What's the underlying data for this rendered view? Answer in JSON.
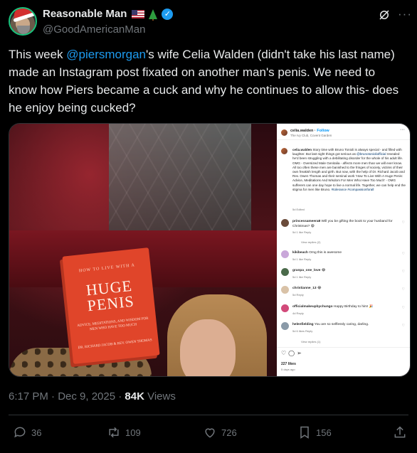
{
  "author": {
    "display_name": "Reasonable Man",
    "handle": "@GoodAmericanMan",
    "verified": true,
    "emoji_badges": [
      "flag-us-icon",
      "christmas-tree-icon"
    ]
  },
  "tweet": {
    "text_before": "This week ",
    "mention": "@piersmorgan",
    "text_after": "'s wife Celia Walden (didn't take his last name) made an Instagram post fixated on  another man's penis. We need to know how Piers became a cuck and why he continues to allow this- does he enjoy being cucked?"
  },
  "media": {
    "book": {
      "top_line": "HOW TO LIVE WITH A",
      "title_line1": "HUGE",
      "title_line2": "PENIS",
      "subtitle": "ADVICE, MEDITATIONS, AND WISDOM FOR MEN WHO HAVE TOO MUCH",
      "authors": "DR. RICHARD JACOB & REV. OWEN THOMAS"
    },
    "instagram": {
      "username": "celia.walden",
      "follow": "Follow",
      "location": "The Ivy Club, Covent Garden",
      "caption_user": "celia.walden",
      "caption_before_link": "Story time with Bruno Tonioli is always special - and filled with laughter. But last night things got serious as ",
      "caption_link": "@brunotonioliofficial",
      "caption_after_link": " revealed he'd been struggling with a debilitating disorder for the whole of his adult life. OMG - Oversized Male Genitalia - affects more men than we will ever know. All too often these men are banished to the fringes of society, victims of their own freakish length and girth. But now, with the help of Dr. Richard Jacob and Rev. Owen Thomas and their seminal work 'How To Live With A Huge Penis: Advice, Meditations And Wisdom For Men Who Have Too Much' - OMG sufferers can one day hope to live a normal life. Together, we can help end the stigma for men like Bruno. ",
      "caption_hashtags": "#tolerance #compassionforall",
      "caption_time": "5d Edited",
      "comments": [
        {
          "user": "princessameera8",
          "text": "Will you be gifting the book to your husband for Christmas? 😆",
          "meta": "5d   1 like   Reply",
          "replies": "View replies (2)"
        },
        {
          "user": "kikibeach",
          "text": "Omg this is awesome",
          "meta": "5d   1 like   Reply",
          "replies": ""
        },
        {
          "user": "granpa_one_love",
          "text": "😂",
          "meta": "5d   1 like   Reply",
          "replies": ""
        },
        {
          "user": "christianne_13",
          "text": "😂",
          "meta": "5d   Reply",
          "replies": ""
        },
        {
          "user": "officialmakeupbychungo",
          "text": "Happy Birthday to him! 🎉",
          "meta": "4d   Reply",
          "replies": ""
        },
        {
          "user": "helenfielding",
          "text": "You are so selflessly caring, darling.",
          "meta": "5d   6 likes   Reply",
          "replies": "View replies (1)"
        }
      ],
      "likes": "227 likes",
      "posted_ago": "5 days ago"
    }
  },
  "meta": {
    "time": "6:17 PM · Dec 9, 2025 · ",
    "views_count": "84K",
    "views_label": " Views"
  },
  "actions": {
    "replies": "36",
    "reposts": "109",
    "likes": "726",
    "bookmarks": "156"
  },
  "colors": {
    "background": "#000000",
    "accent": "#1d9bf0",
    "muted": "#71767b",
    "text": "#e7e9ea"
  }
}
